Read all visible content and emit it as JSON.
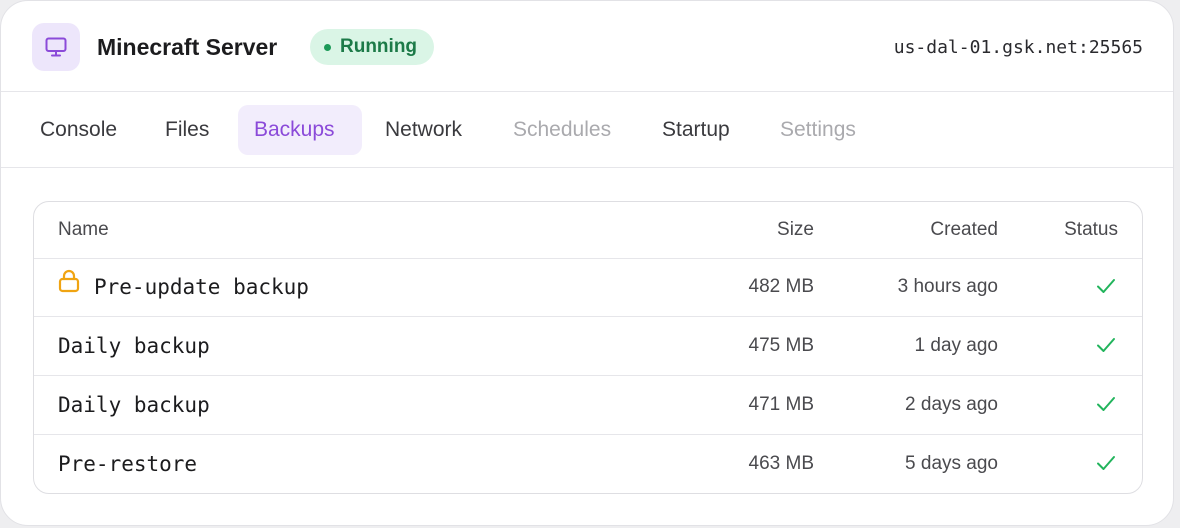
{
  "header": {
    "title": "Minecraft Server",
    "icon": "monitor-icon",
    "status": "Running",
    "status_color": "#1c9a58",
    "address": "us-dal-01.gsk.net:25565"
  },
  "tabs": [
    {
      "label": "Console",
      "state": "normal"
    },
    {
      "label": "Files",
      "state": "normal"
    },
    {
      "label": "Backups",
      "state": "active"
    },
    {
      "label": "Network",
      "state": "normal"
    },
    {
      "label": "Schedules",
      "state": "disabled"
    },
    {
      "label": "Startup",
      "state": "normal"
    },
    {
      "label": "Settings",
      "state": "disabled"
    }
  ],
  "accent_color": "#8b4ad9",
  "table": {
    "columns": {
      "name": "Name",
      "size": "Size",
      "created": "Created",
      "status": "Status"
    },
    "rows": [
      {
        "name": "Pre-update backup",
        "locked": true,
        "size": "482 MB",
        "created": "3 hours ago",
        "status_icon": "check-icon"
      },
      {
        "name": "Daily backup",
        "locked": false,
        "size": "475 MB",
        "created": "1 day ago",
        "status_icon": "check-icon"
      },
      {
        "name": "Daily backup",
        "locked": false,
        "size": "471 MB",
        "created": "2 days ago",
        "status_icon": "check-icon"
      },
      {
        "name": "Pre-restore",
        "locked": false,
        "size": "463 MB",
        "created": "5 days ago",
        "status_icon": "check-icon"
      }
    ]
  }
}
